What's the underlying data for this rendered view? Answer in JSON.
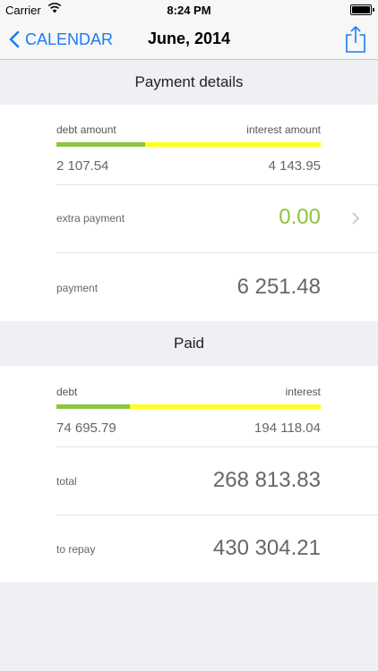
{
  "status": {
    "carrier": "Carrier",
    "time": "8:24 PM"
  },
  "nav": {
    "back_label": "CALENDAR",
    "title": "June, 2014"
  },
  "payment_details": {
    "header": "Payment details",
    "bar": {
      "left_label": "debt amount",
      "right_label": "interest amount",
      "left_value": "2 107.54",
      "right_value": "4 143.95",
      "debt_fraction": 0.337
    },
    "extra_payment": {
      "label": "extra payment",
      "value": "0.00"
    },
    "payment": {
      "label": "payment",
      "value": "6 251.48"
    }
  },
  "paid": {
    "header": "Paid",
    "bar": {
      "left_label": "debt",
      "right_label": "interest",
      "left_value": "74 695.79",
      "right_value": "194 118.04",
      "debt_fraction": 0.278
    },
    "total": {
      "label": "total",
      "value": "268 813.83"
    },
    "to_repay": {
      "label": "to repay",
      "value": "430 304.21"
    }
  },
  "colors": {
    "accent": "#1a7cf5",
    "debt": "#8cc53f",
    "interest": "#ffff1a"
  },
  "icons": {
    "back": "chevron-left-icon",
    "share": "share-icon",
    "disclosure": "chevron-right-icon"
  }
}
